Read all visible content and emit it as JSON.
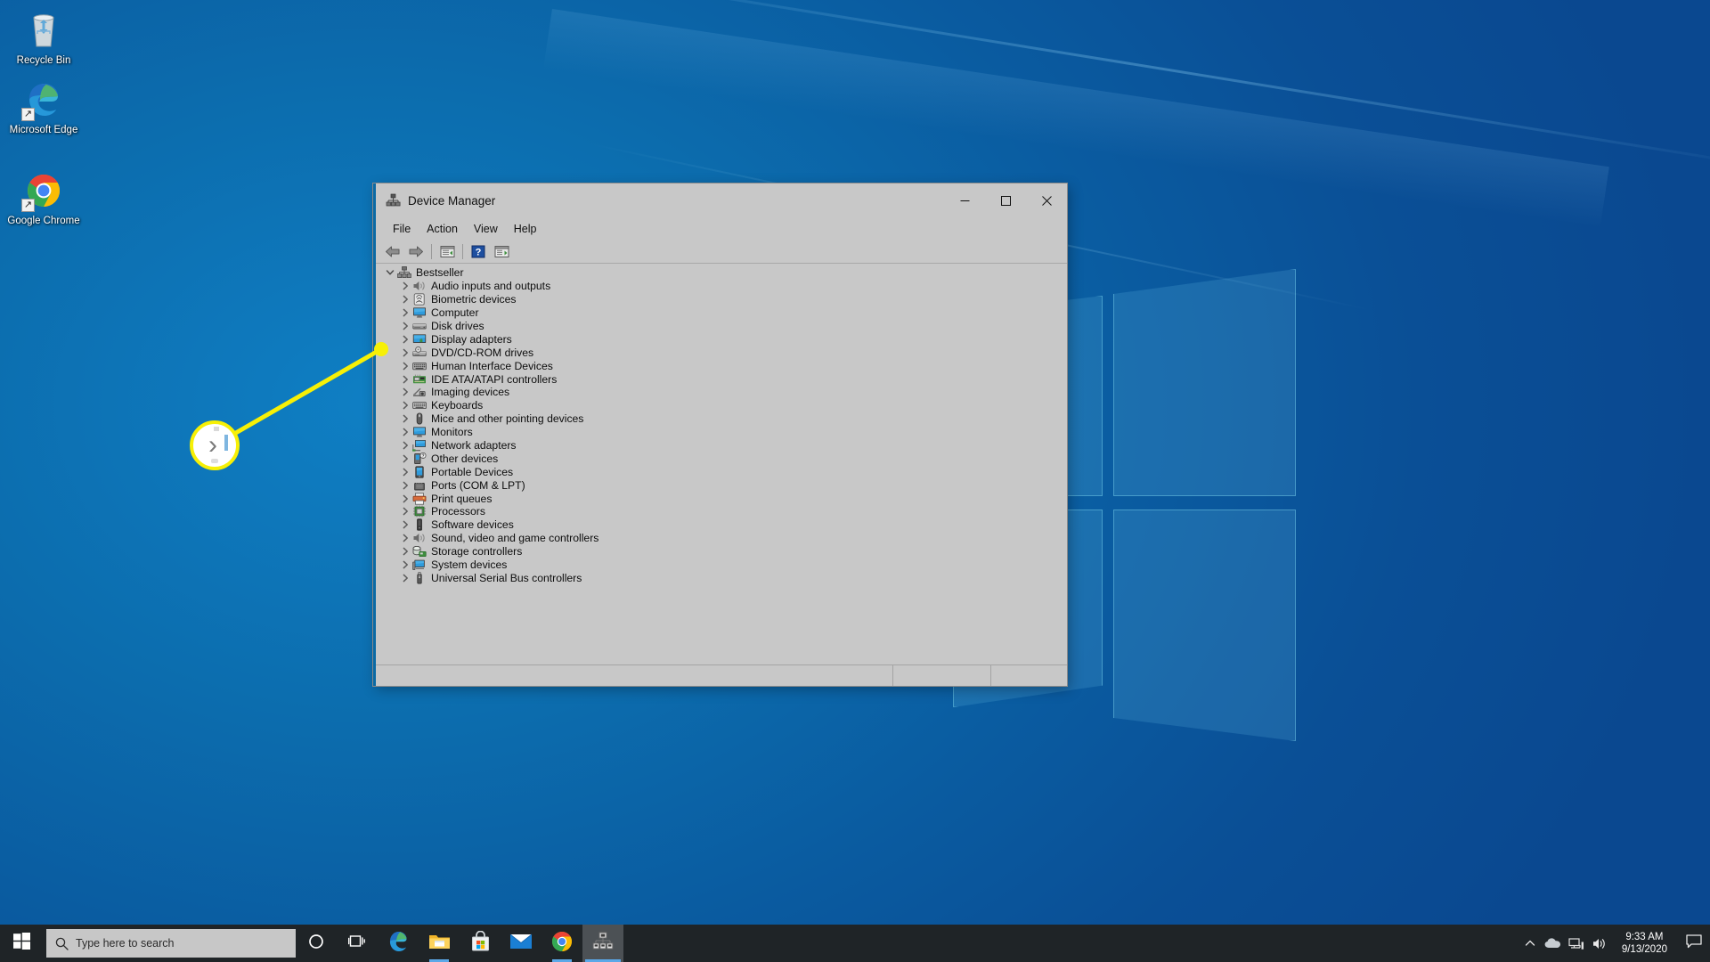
{
  "desktop": {
    "icons": [
      {
        "name": "recycle-bin",
        "label": "Recycle Bin"
      },
      {
        "name": "microsoft-edge",
        "label": "Microsoft Edge"
      },
      {
        "name": "google-chrome",
        "label": "Google Chrome"
      }
    ],
    "wallpaper_colors": {
      "blue_light": "#0f7fc4",
      "blue_mid": "#0c6dae",
      "blue_dark": "#0a4890",
      "logo_fill": "rgba(120,210,245,0.17)"
    }
  },
  "window": {
    "title": "Device Manager",
    "title_icon": "device-manager-icon",
    "controls": {
      "minimize": "—",
      "maximize": "□",
      "close": "✕"
    },
    "menu": [
      "File",
      "Action",
      "View",
      "Help"
    ],
    "toolbar": [
      {
        "name": "back-button",
        "icon": "back-arrow-icon"
      },
      {
        "name": "forward-button",
        "icon": "forward-arrow-icon"
      },
      {
        "name": "properties-button",
        "icon": "properties-icon"
      },
      {
        "name": "help-button",
        "icon": "help-question-icon"
      },
      {
        "name": "show-hide-console-tree-button",
        "icon": "console-tree-icon"
      }
    ],
    "status_bar": {
      "pane1": "",
      "pane2": "",
      "pane3": ""
    }
  },
  "tree": {
    "root": {
      "label": "Bestseller",
      "icon": "computer-node-icon",
      "expanded": true,
      "twisty": "chevron-down-icon"
    },
    "items": [
      {
        "label": "Audio inputs and outputs",
        "icon": "speaker-icon"
      },
      {
        "label": "Biometric devices",
        "icon": "fingerprint-icon"
      },
      {
        "label": "Computer",
        "icon": "monitor-icon"
      },
      {
        "label": "Disk drives",
        "icon": "hard-disk-icon"
      },
      {
        "label": "Display adapters",
        "icon": "display-adapter-icon"
      },
      {
        "label": "DVD/CD-ROM drives",
        "icon": "optical-drive-icon"
      },
      {
        "label": "Human Interface Devices",
        "icon": "keyboard-hid-icon"
      },
      {
        "label": "IDE ATA/ATAPI controllers",
        "icon": "ide-controller-icon"
      },
      {
        "label": "Imaging devices",
        "icon": "camera-icon"
      },
      {
        "label": "Keyboards",
        "icon": "keyboard-icon"
      },
      {
        "label": "Mice and other pointing devices",
        "icon": "mouse-icon"
      },
      {
        "label": "Monitors",
        "icon": "monitor-icon"
      },
      {
        "label": "Network adapters",
        "icon": "network-adapter-icon"
      },
      {
        "label": "Other devices",
        "icon": "unknown-device-icon"
      },
      {
        "label": "Portable Devices",
        "icon": "portable-device-icon"
      },
      {
        "label": "Ports (COM & LPT)",
        "icon": "port-connector-icon"
      },
      {
        "label": "Print queues",
        "icon": "printer-icon"
      },
      {
        "label": "Processors",
        "icon": "processor-chip-icon"
      },
      {
        "label": "Software devices",
        "icon": "software-device-icon"
      },
      {
        "label": "Sound, video and game controllers",
        "icon": "speaker-icon"
      },
      {
        "label": "Storage controllers",
        "icon": "storage-controller-icon"
      },
      {
        "label": "System devices",
        "icon": "system-device-icon"
      },
      {
        "label": "Universal Serial Bus controllers",
        "icon": "usb-icon"
      }
    ],
    "child_twisty": "chevron-right-icon"
  },
  "callout": {
    "magnified_glyph": "›",
    "target_label": "Display adapters",
    "ring_color": "#f7f006",
    "line_color": "#f7f006"
  },
  "taskbar": {
    "start": {
      "name": "start-button",
      "icon": "windows-logo-icon"
    },
    "search": {
      "placeholder": "Type here to search",
      "icon": "search-icon"
    },
    "cortana": {
      "name": "cortana-button",
      "icon": "cortana-circle-icon"
    },
    "taskview": {
      "name": "task-view-button",
      "icon": "task-view-icon"
    },
    "apps": [
      {
        "name": "taskbar-edge",
        "icon": "edge-icon",
        "state": "pinned"
      },
      {
        "name": "taskbar-file-explorer",
        "icon": "folder-icon",
        "state": "running"
      },
      {
        "name": "taskbar-microsoft-store",
        "icon": "store-bag-icon",
        "state": "pinned"
      },
      {
        "name": "taskbar-mail",
        "icon": "mail-envelope-icon",
        "state": "pinned"
      },
      {
        "name": "taskbar-chrome",
        "icon": "chrome-icon",
        "state": "running"
      },
      {
        "name": "taskbar-device-manager",
        "icon": "device-manager-icon",
        "state": "active"
      }
    ],
    "tray": [
      {
        "name": "show-hidden-icons",
        "icon": "chevron-up-icon"
      },
      {
        "name": "onedrive-tray-icon",
        "icon": "cloud-icon"
      },
      {
        "name": "network-tray-icon",
        "icon": "network-icon"
      },
      {
        "name": "volume-tray-icon",
        "icon": "speaker-volume-icon"
      }
    ],
    "clock": {
      "time": "9:33 AM",
      "date": "9/13/2020"
    },
    "notifications": {
      "name": "action-center-button",
      "icon": "speech-bubble-icon"
    }
  }
}
